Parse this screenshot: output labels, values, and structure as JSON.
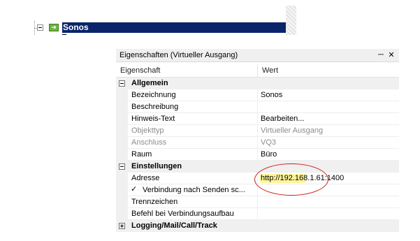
{
  "tree": {
    "selected_node_label": "Sonos",
    "icon": "arrow-right-icon"
  },
  "panel": {
    "title": "Eigenschaften (Virtueller Ausgang)",
    "pin_glyph": "⎓",
    "close_glyph": "✕",
    "columns": {
      "property": "Eigenschaft",
      "value": "Wert"
    },
    "rows": [
      {
        "kind": "category",
        "name": "Allgemein",
        "expanded": true
      },
      {
        "kind": "prop",
        "name": "Bezeichnung",
        "value": "Sonos"
      },
      {
        "kind": "prop",
        "name": "Beschreibung",
        "value": ""
      },
      {
        "kind": "prop",
        "name": "Hinweis-Text",
        "value": "Bearbeiten..."
      },
      {
        "kind": "prop",
        "name": "Objekttyp",
        "value": "Virtueller Ausgang",
        "disabled": true
      },
      {
        "kind": "prop",
        "name": "Anschluss",
        "value": "VQ3",
        "disabled": true
      },
      {
        "kind": "prop",
        "name": "Raum",
        "value": "Büro"
      },
      {
        "kind": "category",
        "name": "Einstellungen",
        "expanded": true
      },
      {
        "kind": "prop",
        "name": "Adresse",
        "value": "http://192.168.1.61:1400"
      },
      {
        "kind": "check",
        "name": "Verbindung nach Senden sc...",
        "value": "",
        "checked": true,
        "check_glyph": "✓"
      },
      {
        "kind": "prop",
        "name": "Trennzeichen",
        "value": ""
      },
      {
        "kind": "prop",
        "name": "Befehl bei Verbindungsaufbau",
        "value": ""
      },
      {
        "kind": "category",
        "name": "Logging/Mail/Call/Track",
        "expanded": false
      }
    ]
  },
  "colors": {
    "selection": "#0a246a",
    "highlight": "#fff59a",
    "annotation": "#cc1f1f"
  }
}
